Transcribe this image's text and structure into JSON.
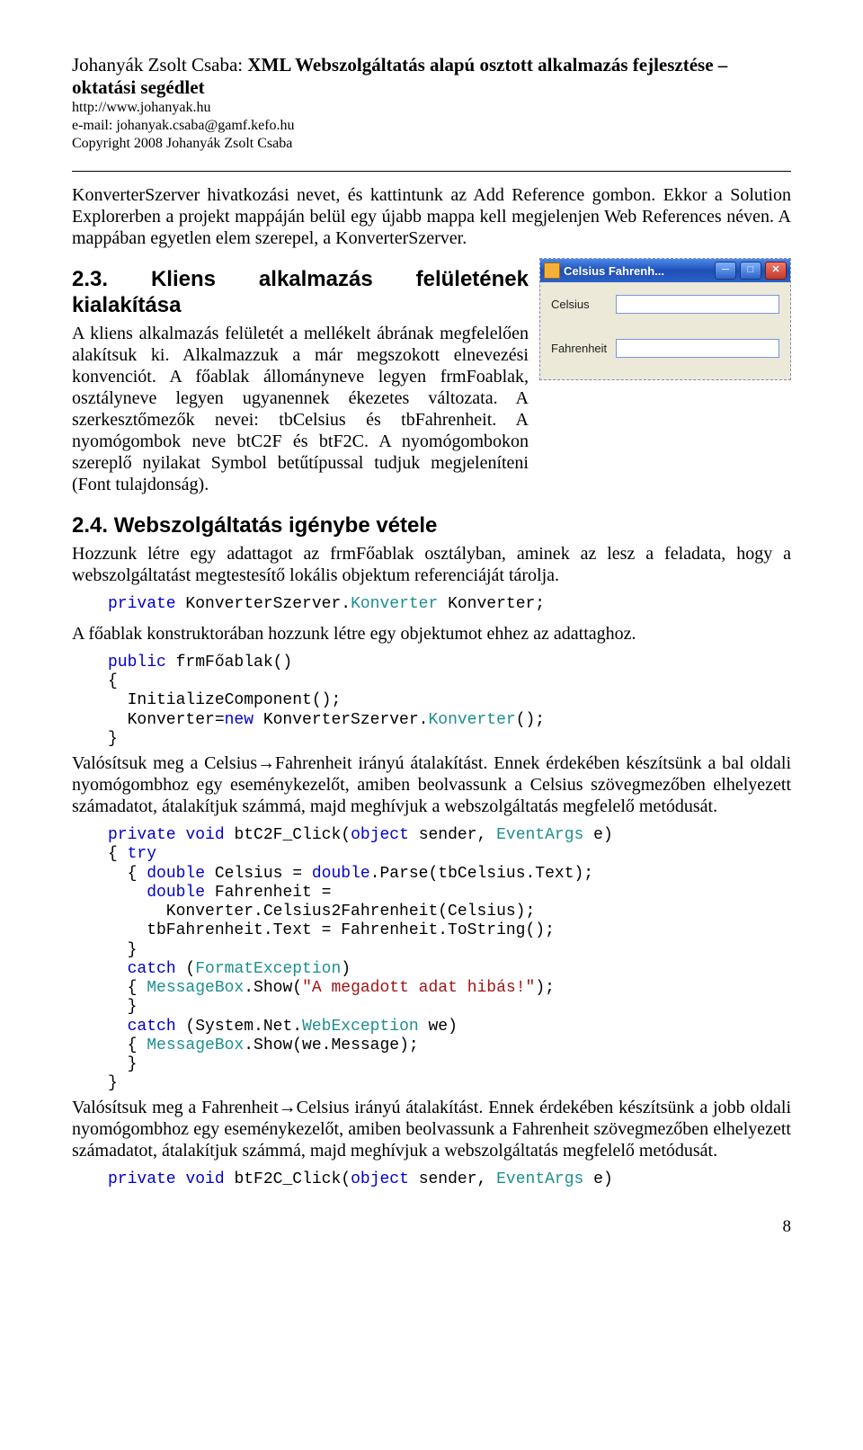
{
  "header": {
    "author": "Johanyák Zsolt Csaba:",
    "title1": "XML Webszolgáltatás alapú osztott alkalmazás fejlesztése –",
    "title2": "oktatási segédlet",
    "url": "http://www.johanyak.hu",
    "email": "e-mail: johanyak.csaba@gamf.kefo.hu",
    "copyright": "Copyright 2008 Johanyák Zsolt Csaba"
  },
  "intro": "KonverterSzerver hivatkozási nevet, és kattintunk az Add Reference gombon. Ekkor a Solution Explorerben a projekt mappáján belül egy újabb mappa kell megjelenjen Web References néven. A mappában egyetlen elem szerepel, a KonverterSzerver.",
  "sec23_title": "2.3. Kliens alkalmazás felületének kialakítása",
  "sec23_body": "A kliens alkalmazás felületét a mellékelt ábrának megfelelően alakítsuk ki. Alkalmazzuk a már megszokott elnevezési konvenciót. A főablak állományneve legyen frmFoablak, osztályneve legyen ugyanennek ékezetes változata. A szerkesztőmezők nevei: tbCelsius és tbFahrenheit. A nyomógombok neve btC2F és btF2C. A nyomógombokon szereplő nyilakat Symbol betűtípussal tudjuk megjeleníteni (Font tulajdonság).",
  "win": {
    "title": "Celsius Fahrenh...",
    "label1": "Celsius",
    "label2": "Fahrenheit"
  },
  "sec24_title": "2.4. Webszolgáltatás igénybe vétele",
  "sec24_p1": "Hozzunk létre egy adattagot az frmFőablak osztályban, aminek az lesz a feladata, hogy a webszolgáltatást megtestesítő lokális objektum referenciáját tárolja.",
  "code1": {
    "line1a": "private",
    "line1b": " KonverterSzerver.",
    "line1c": "Konverter",
    "line1d": " Konverter;"
  },
  "sec24_p2": "A főablak konstruktorában hozzunk létre egy objektumot ehhez az adattaghoz.",
  "code2": {
    "l1a": "public",
    "l1b": " frmFőablak()",
    "l2": "{",
    "l3": "  InitializeComponent();",
    "l4a": "  Konverter=",
    "l4b": "new",
    "l4c": " KonverterSzerver.",
    "l4d": "Konverter",
    "l4e": "();",
    "l5": "}"
  },
  "sec24_p3": "Valósítsuk meg a Celsius→Fahrenheit irányú átalakítást. Ennek érdekében készítsünk a bal oldali nyomógombhoz egy eseménykezelőt, amiben beolvassunk a Celsius szövegmezőben elhelyezett számadatot, átalakítjuk számmá, majd meghívjuk a webszolgáltatás megfelelő metódusát.",
  "code3": {
    "l1a": "private",
    "l1b": " ",
    "l1c": "void",
    "l1d": " btC2F_Click(",
    "l1e": "object",
    "l1f": " sender, ",
    "l1g": "EventArgs",
    "l1h": " e)",
    "l2a": "{ ",
    "l2b": "try",
    "l3a": "  { ",
    "l3b": "double",
    "l3c": " Celsius = ",
    "l3d": "double",
    "l3e": ".Parse(tbCelsius.Text);",
    "l4a": "    ",
    "l4b": "double",
    "l4c": " Fahrenheit =",
    "l5": "      Konverter.Celsius2Fahrenheit(Celsius);",
    "l6": "    tbFahrenheit.Text = Fahrenheit.ToString();",
    "l7": "  }",
    "l8a": "  ",
    "l8b": "catch",
    "l8c": " (",
    "l8d": "FormatException",
    "l8e": ")",
    "l9a": "  { ",
    "l9b": "MessageBox",
    "l9c": ".Show(",
    "l9d": "\"A megadott adat hibás!\"",
    "l9e": ");",
    "l10": "  }",
    "l11a": "  ",
    "l11b": "catch",
    "l11c": " (System.Net.",
    "l11d": "WebException",
    "l11e": " we)",
    "l12a": "  { ",
    "l12b": "MessageBox",
    "l12c": ".Show(we.Message);",
    "l13": "  }",
    "l14": "}"
  },
  "sec24_p4": "Valósítsuk meg a Fahrenheit→Celsius irányú átalakítást. Ennek érdekében készítsünk a jobb oldali nyomógombhoz egy eseménykezelőt, amiben beolvassunk a Fahrenheit szövegmezőben elhelyezett számadatot, átalakítjuk számmá, majd meghívjuk a webszolgáltatás megfelelő metódusát.",
  "code4": {
    "l1a": "private",
    "l1b": " ",
    "l1c": "void",
    "l1d": " btF2C_Click(",
    "l1e": "object",
    "l1f": " sender, ",
    "l1g": "EventArgs",
    "l1h": " e)"
  },
  "page_number": "8"
}
